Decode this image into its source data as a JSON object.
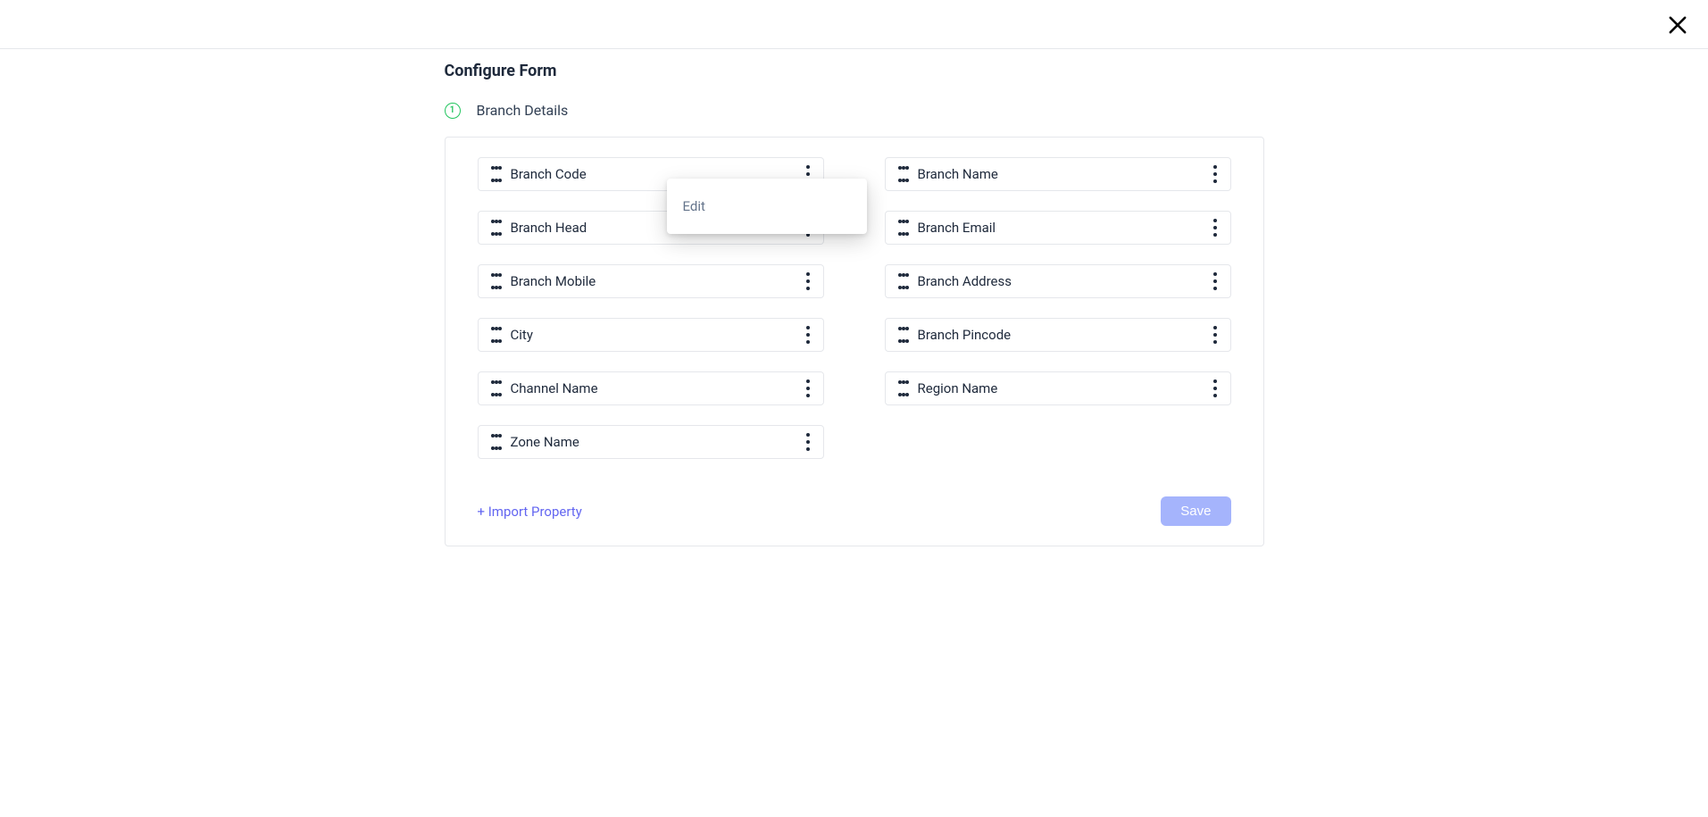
{
  "page": {
    "title": "Configure Form"
  },
  "section": {
    "step_number": "1",
    "title": "Branch Details"
  },
  "fields": {
    "left": [
      {
        "label": "Branch Code"
      },
      {
        "label": "Branch Head"
      },
      {
        "label": "Branch Mobile"
      },
      {
        "label": "City"
      },
      {
        "label": "Channel Name"
      },
      {
        "label": "Zone Name"
      }
    ],
    "right": [
      {
        "label": "Branch Name"
      },
      {
        "label": "Branch Email"
      },
      {
        "label": "Branch Address"
      },
      {
        "label": "Branch Pincode"
      },
      {
        "label": "Region Name"
      }
    ]
  },
  "footer": {
    "import_label": "+ Import Property",
    "save_label": "Save"
  },
  "popover": {
    "edit_label": "Edit"
  }
}
